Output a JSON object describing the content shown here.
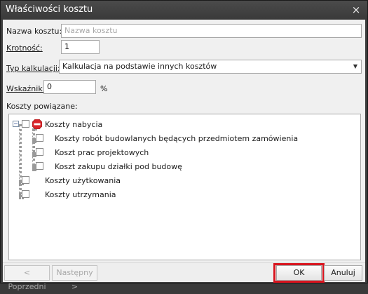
{
  "window": {
    "title": "Właściwości kosztu",
    "close_glyph": "×"
  },
  "form": {
    "name_label": "Nazwa kosztu:",
    "name_placeholder": "Nazwa kosztu",
    "multiplicity_label": "Krotność:",
    "multiplicity_value": "1",
    "calc_type_label": "Typ kalkulacji:",
    "calc_type_value": "Kalkulacja na podstawie innych kosztów",
    "indicator_label": "Wskaźnik:",
    "indicator_value": "0",
    "indicator_unit": "%",
    "related_label": "Koszty powiązane:"
  },
  "tree": {
    "root": {
      "label": "Koszty nabycia",
      "icon": "stop-icon",
      "expander": "−"
    },
    "children": [
      {
        "label": "Koszty robót budowlanych będących przedmiotem zamówienia"
      },
      {
        "label": "Koszt prac projektowych"
      },
      {
        "label": "Koszt zakupu działki pod budowę"
      }
    ],
    "siblings": [
      {
        "label": "Koszty użytkowania"
      },
      {
        "label": "Koszty utrzymania"
      }
    ]
  },
  "footer": {
    "prev_label": "< Poprzedni",
    "next_label": "Następny >",
    "ok_label": "OK",
    "cancel_label": "Anuluj"
  },
  "colors": {
    "highlight_frame": "#d8141e",
    "stop_icon": "#d9262b"
  }
}
